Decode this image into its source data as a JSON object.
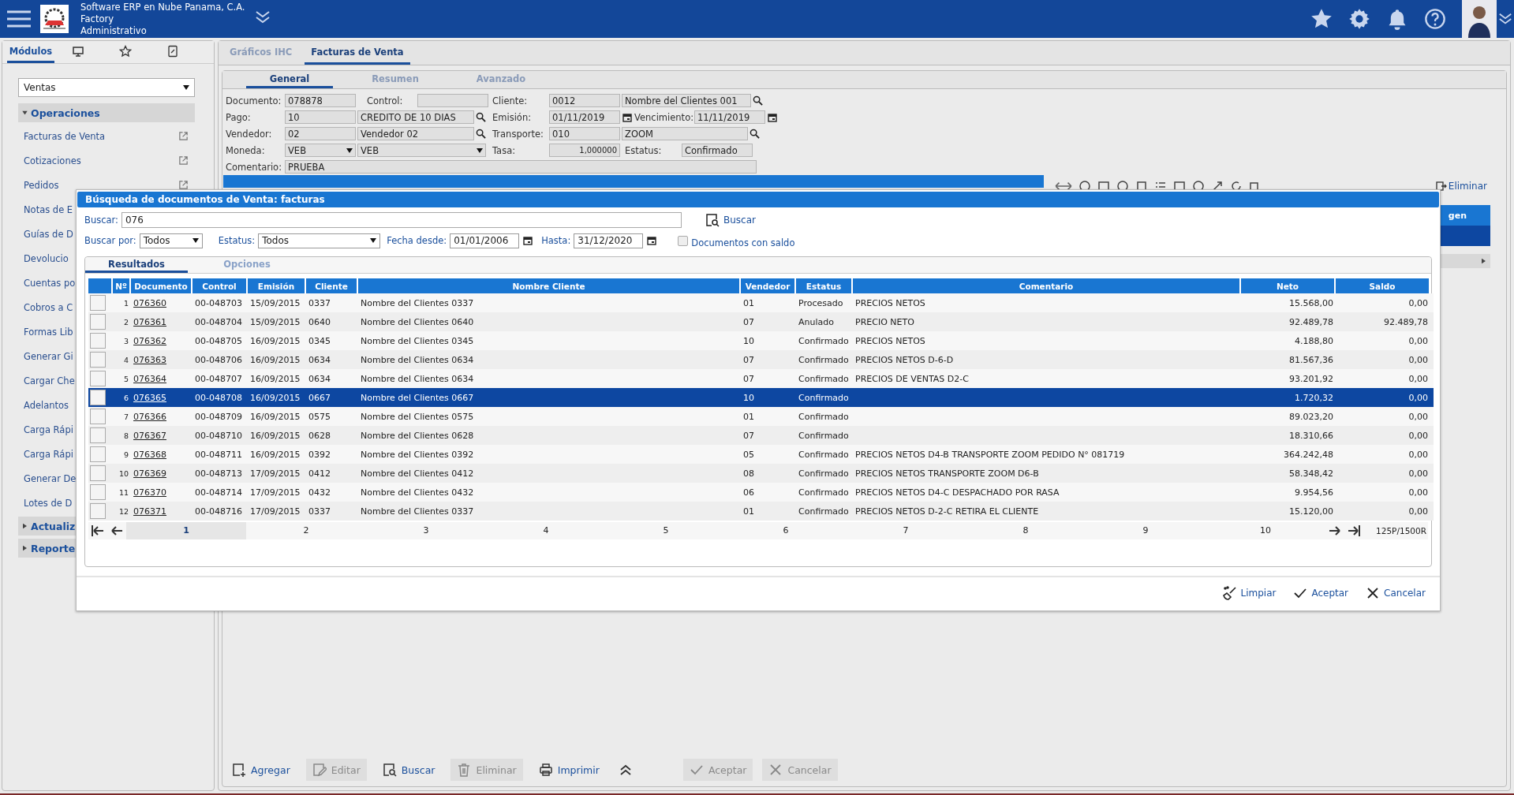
{
  "header": {
    "company": "Software ERP en Nube Panama, C.A.",
    "branch": "Factory",
    "role": "Administrativo"
  },
  "sidebar": {
    "tabs": [
      {
        "kind": "text",
        "label": "Módulos",
        "selected": true
      },
      {
        "kind": "monitor",
        "selected": false
      },
      {
        "kind": "star",
        "selected": false
      },
      {
        "kind": "document",
        "selected": false
      }
    ],
    "module": "Ventas",
    "groups": [
      {
        "label": "Operaciones",
        "expanded": true,
        "items": [
          {
            "label": "Facturas de Venta",
            "external_link": true
          },
          {
            "label": "Cotizaciones",
            "external_link": true
          },
          {
            "label": "Pedidos",
            "external_link": true
          },
          {
            "label": "Notas de E"
          },
          {
            "label": "Guías de D"
          },
          {
            "label": "Devolucio"
          },
          {
            "label": "Cuentas po"
          },
          {
            "label": "Cobros a C"
          },
          {
            "label": "Formas Lib"
          },
          {
            "label": "Generar Gi"
          },
          {
            "label": "Cargar Che"
          },
          {
            "label": "Adelantos"
          },
          {
            "label": "Carga Rápi"
          },
          {
            "label": "Carga Rápi"
          },
          {
            "label": "Generar De"
          },
          {
            "label": "Lotes de D"
          }
        ]
      },
      {
        "label": "Actualiz",
        "expanded": false
      },
      {
        "label": "Reporte",
        "expanded": false
      }
    ]
  },
  "main_tabs": [
    {
      "label": "Gráficos IHC",
      "selected": false
    },
    {
      "label": "Facturas de Venta",
      "selected": true
    }
  ],
  "form_tabs": [
    {
      "label": "General",
      "selected": true
    },
    {
      "label": "Resumen",
      "selected": false
    },
    {
      "label": "Avanzado",
      "selected": false
    }
  ],
  "form": {
    "documento": {
      "label": "Documento:",
      "value": "078878"
    },
    "control": {
      "label": "Control:"
    },
    "cliente": {
      "label": "Cliente:",
      "code": "0012",
      "name": "Nombre del Clientes 001"
    },
    "pago": {
      "label": "Pago:",
      "code": "10",
      "name": "CREDITO DE 10 DIAS"
    },
    "emision": {
      "label": "Emisión:",
      "value": "01/11/2019"
    },
    "vencimiento": {
      "label": "Vencimiento:",
      "value": "11/11/2019"
    },
    "vendedor": {
      "label": "Vendedor:",
      "code": "02",
      "name": "Vendedor 02"
    },
    "transporte": {
      "label": "Transporte:",
      "code": "010",
      "name": "ZOOM"
    },
    "moneda": {
      "label": "Moneda:",
      "code": "VEB",
      "name": "VEB"
    },
    "tasa": {
      "label": "Tasa:",
      "value": "1,000000"
    },
    "estatus": {
      "label": "Estatus:",
      "value": "Confirmado"
    },
    "comentario": {
      "label": "Comentario:",
      "value": "PRUEBA"
    }
  },
  "detail": {
    "action": "Eliminar",
    "column_fragment": "gen"
  },
  "bottom_toolbar": [
    {
      "kind": "add",
      "label": "Agregar",
      "disabled": false
    },
    {
      "kind": "edit",
      "label": "Editar",
      "disabled": true
    },
    {
      "kind": "search",
      "label": "Buscar",
      "disabled": false
    },
    {
      "kind": "delete",
      "label": "Eliminar",
      "disabled": true
    },
    {
      "kind": "print",
      "label": "Imprimir",
      "disabled": false
    },
    {
      "kind": "collapse",
      "disabled": false
    },
    {
      "kind": "accept",
      "label": "Aceptar",
      "disabled": true
    },
    {
      "kind": "cancel",
      "label": "Cancelar",
      "disabled": true
    }
  ],
  "dialog": {
    "title": "Búsqueda de documentos de Venta: facturas",
    "search": {
      "label": "Buscar:",
      "value": "076",
      "button": "Buscar"
    },
    "filters": {
      "by_label": "Buscar por:",
      "by_value": "Todos",
      "status_label": "Estatus:",
      "status_value": "Todos",
      "from_label": "Fecha desde:",
      "from_value": "01/01/2006",
      "to_label": "Hasta:",
      "to_value": "31/12/2020",
      "balance_label": "Documentos con saldo",
      "balance_checked": false
    },
    "tabs": [
      {
        "label": "Resultados",
        "selected": true
      },
      {
        "label": "Opciones",
        "selected": false
      }
    ],
    "table": {
      "columns": [
        "Nº",
        "Documento",
        "Control",
        "Emisión",
        "Cliente",
        "Nombre Cliente",
        "Vendedor",
        "Estatus",
        "Comentario",
        "Neto",
        "Saldo"
      ],
      "rows": [
        {
          "n": "1",
          "documento": "076360",
          "control": "00-048703",
          "emision": "15/09/2015",
          "cliente": "0337",
          "nombre_cliente": "Nombre del Clientes 0337",
          "vendedor": "01",
          "estatus": "Procesado",
          "comentario": "PRECIOS NETOS",
          "neto": "15.568,00",
          "saldo": "0,00",
          "checked": false,
          "selected": false
        },
        {
          "n": "2",
          "documento": "076361",
          "control": "00-048704",
          "emision": "15/09/2015",
          "cliente": "0640",
          "nombre_cliente": "Nombre del Clientes 0640",
          "vendedor": "07",
          "estatus": "Anulado",
          "comentario": "PRECIO NETO",
          "neto": "92.489,78",
          "saldo": "92.489,78",
          "checked": false,
          "selected": false
        },
        {
          "n": "3",
          "documento": "076362",
          "control": "00-048705",
          "emision": "16/09/2015",
          "cliente": "0345",
          "nombre_cliente": "Nombre del Clientes 0345",
          "vendedor": "10",
          "estatus": "Confirmado",
          "comentario": "PRECIOS NETOS",
          "neto": "4.188,80",
          "saldo": "0,00",
          "checked": false,
          "selected": false
        },
        {
          "n": "4",
          "documento": "076363",
          "control": "00-048706",
          "emision": "16/09/2015",
          "cliente": "0634",
          "nombre_cliente": "Nombre del Clientes 0634",
          "vendedor": "07",
          "estatus": "Confirmado",
          "comentario": "PRECIOS NETOS D-6-D",
          "neto": "81.567,36",
          "saldo": "0,00",
          "checked": false,
          "selected": false
        },
        {
          "n": "5",
          "documento": "076364",
          "control": "00-048707",
          "emision": "16/09/2015",
          "cliente": "0634",
          "nombre_cliente": "Nombre del Clientes 0634",
          "vendedor": "07",
          "estatus": "Confirmado",
          "comentario": "PRECIOS DE VENTAS D2-C",
          "neto": "93.201,92",
          "saldo": "0,00",
          "checked": false,
          "selected": false
        },
        {
          "n": "6",
          "documento": "076365",
          "control": "00-048708",
          "emision": "16/09/2015",
          "cliente": "0667",
          "nombre_cliente": "Nombre del Clientes 0667",
          "vendedor": "10",
          "estatus": "Confirmado",
          "neto": "1.720,32",
          "saldo": "0,00",
          "checked": false,
          "selected": true
        },
        {
          "n": "7",
          "documento": "076366",
          "control": "00-048709",
          "emision": "16/09/2015",
          "cliente": "0575",
          "nombre_cliente": "Nombre del Clientes 0575",
          "vendedor": "01",
          "estatus": "Confirmado",
          "neto": "89.023,20",
          "saldo": "0,00",
          "checked": false,
          "selected": false
        },
        {
          "n": "8",
          "documento": "076367",
          "control": "00-048710",
          "emision": "16/09/2015",
          "cliente": "0628",
          "nombre_cliente": "Nombre del Clientes 0628",
          "vendedor": "07",
          "estatus": "Confirmado",
          "neto": "18.310,66",
          "saldo": "0,00",
          "checked": false,
          "selected": false
        },
        {
          "n": "9",
          "documento": "076368",
          "control": "00-048711",
          "emision": "16/09/2015",
          "cliente": "0392",
          "nombre_cliente": "Nombre del Clientes 0392",
          "vendedor": "05",
          "estatus": "Confirmado",
          "comentario": "PRECIOS NETOS D4-B TRANSPORTE ZOOM PEDIDO N° 081719",
          "neto": "364.242,48",
          "saldo": "0,00",
          "checked": false,
          "selected": false
        },
        {
          "n": "10",
          "documento": "076369",
          "control": "00-048713",
          "emision": "17/09/2015",
          "cliente": "0412",
          "nombre_cliente": "Nombre del Clientes 0412",
          "vendedor": "08",
          "estatus": "Confirmado",
          "comentario": "PRECIOS NETOS TRANSPORTE ZOOM D6-B",
          "neto": "58.348,42",
          "saldo": "0,00",
          "checked": false,
          "selected": false
        },
        {
          "n": "11",
          "documento": "076370",
          "control": "00-048714",
          "emision": "17/09/2015",
          "cliente": "0432",
          "nombre_cliente": "Nombre del Clientes 0432",
          "vendedor": "06",
          "estatus": "Confirmado",
          "comentario": "PRECIOS NETOS D4-C DESPACHADO POR RASA",
          "neto": "9.954,56",
          "saldo": "0,00",
          "checked": false,
          "selected": false
        },
        {
          "n": "12",
          "documento": "076371",
          "control": "00-048716",
          "emision": "17/09/2015",
          "cliente": "0337",
          "nombre_cliente": "Nombre del Clientes 0337",
          "vendedor": "01",
          "estatus": "Confirmado",
          "comentario": "PRECIOS NETOS D-2-C RETIRA EL CLIENTE",
          "neto": "15.120,00",
          "saldo": "0,00",
          "checked": false,
          "selected": false
        }
      ]
    },
    "pagination": {
      "pages": [
        {
          "label": "1",
          "selected": true
        },
        {
          "label": "2",
          "selected": false
        },
        {
          "label": "3",
          "selected": false
        },
        {
          "label": "4",
          "selected": false
        },
        {
          "label": "5",
          "selected": false
        },
        {
          "label": "6",
          "selected": false
        },
        {
          "label": "7",
          "selected": false
        },
        {
          "label": "8",
          "selected": false
        },
        {
          "label": "9",
          "selected": false
        },
        {
          "label": "10",
          "selected": false
        }
      ],
      "summary": "125P/1500R"
    },
    "buttons": [
      {
        "kind": "clear",
        "label": "Limpiar"
      },
      {
        "kind": "accept",
        "label": "Aceptar"
      },
      {
        "kind": "cancel",
        "label": "Cancelar"
      }
    ]
  }
}
